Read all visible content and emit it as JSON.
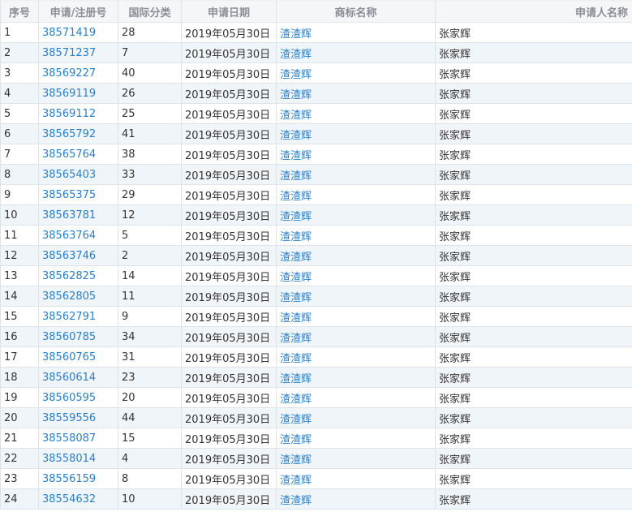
{
  "table": {
    "headers": {
      "seq": "序号",
      "reg_no": "申请/注册号",
      "intl_class": "国际分类",
      "apply_date": "申请日期",
      "tm_name": "商标名称",
      "applicant": "申请人名称"
    },
    "rows": [
      {
        "seq": "1",
        "reg_no": "38571419",
        "intl_class": "28",
        "apply_date": "2019年05月30日",
        "tm_name": "渣渣辉",
        "applicant": "张家辉"
      },
      {
        "seq": "2",
        "reg_no": "38571237",
        "intl_class": "7",
        "apply_date": "2019年05月30日",
        "tm_name": "渣渣辉",
        "applicant": "张家辉"
      },
      {
        "seq": "3",
        "reg_no": "38569227",
        "intl_class": "40",
        "apply_date": "2019年05月30日",
        "tm_name": "渣渣辉",
        "applicant": "张家辉"
      },
      {
        "seq": "4",
        "reg_no": "38569119",
        "intl_class": "26",
        "apply_date": "2019年05月30日",
        "tm_name": "渣渣辉",
        "applicant": "张家辉"
      },
      {
        "seq": "5",
        "reg_no": "38569112",
        "intl_class": "25",
        "apply_date": "2019年05月30日",
        "tm_name": "渣渣辉",
        "applicant": "张家辉"
      },
      {
        "seq": "6",
        "reg_no": "38565792",
        "intl_class": "41",
        "apply_date": "2019年05月30日",
        "tm_name": "渣渣辉",
        "applicant": "张家辉"
      },
      {
        "seq": "7",
        "reg_no": "38565764",
        "intl_class": "38",
        "apply_date": "2019年05月30日",
        "tm_name": "渣渣辉",
        "applicant": "张家辉"
      },
      {
        "seq": "8",
        "reg_no": "38565403",
        "intl_class": "33",
        "apply_date": "2019年05月30日",
        "tm_name": "渣渣辉",
        "applicant": "张家辉"
      },
      {
        "seq": "9",
        "reg_no": "38565375",
        "intl_class": "29",
        "apply_date": "2019年05月30日",
        "tm_name": "渣渣辉",
        "applicant": "张家辉"
      },
      {
        "seq": "10",
        "reg_no": "38563781",
        "intl_class": "12",
        "apply_date": "2019年05月30日",
        "tm_name": "渣渣辉",
        "applicant": "张家辉"
      },
      {
        "seq": "11",
        "reg_no": "38563764",
        "intl_class": "5",
        "apply_date": "2019年05月30日",
        "tm_name": "渣渣辉",
        "applicant": "张家辉"
      },
      {
        "seq": "12",
        "reg_no": "38563746",
        "intl_class": "2",
        "apply_date": "2019年05月30日",
        "tm_name": "渣渣辉",
        "applicant": "张家辉"
      },
      {
        "seq": "13",
        "reg_no": "38562825",
        "intl_class": "14",
        "apply_date": "2019年05月30日",
        "tm_name": "渣渣辉",
        "applicant": "张家辉"
      },
      {
        "seq": "14",
        "reg_no": "38562805",
        "intl_class": "11",
        "apply_date": "2019年05月30日",
        "tm_name": "渣渣辉",
        "applicant": "张家辉"
      },
      {
        "seq": "15",
        "reg_no": "38562791",
        "intl_class": "9",
        "apply_date": "2019年05月30日",
        "tm_name": "渣渣辉",
        "applicant": "张家辉"
      },
      {
        "seq": "16",
        "reg_no": "38560785",
        "intl_class": "34",
        "apply_date": "2019年05月30日",
        "tm_name": "渣渣辉",
        "applicant": "张家辉"
      },
      {
        "seq": "17",
        "reg_no": "38560765",
        "intl_class": "31",
        "apply_date": "2019年05月30日",
        "tm_name": "渣渣辉",
        "applicant": "张家辉"
      },
      {
        "seq": "18",
        "reg_no": "38560614",
        "intl_class": "23",
        "apply_date": "2019年05月30日",
        "tm_name": "渣渣辉",
        "applicant": "张家辉"
      },
      {
        "seq": "19",
        "reg_no": "38560595",
        "intl_class": "20",
        "apply_date": "2019年05月30日",
        "tm_name": "渣渣辉",
        "applicant": "张家辉"
      },
      {
        "seq": "20",
        "reg_no": "38559556",
        "intl_class": "44",
        "apply_date": "2019年05月30日",
        "tm_name": "渣渣辉",
        "applicant": "张家辉"
      },
      {
        "seq": "21",
        "reg_no": "38558087",
        "intl_class": "15",
        "apply_date": "2019年05月30日",
        "tm_name": "渣渣辉",
        "applicant": "张家辉"
      },
      {
        "seq": "22",
        "reg_no": "38558014",
        "intl_class": "4",
        "apply_date": "2019年05月30日",
        "tm_name": "渣渣辉",
        "applicant": "张家辉"
      },
      {
        "seq": "23",
        "reg_no": "38556159",
        "intl_class": "8",
        "apply_date": "2019年05月30日",
        "tm_name": "渣渣辉",
        "applicant": "张家辉"
      },
      {
        "seq": "24",
        "reg_no": "38554632",
        "intl_class": "10",
        "apply_date": "2019年05月30日",
        "tm_name": "渣渣辉",
        "applicant": "张家辉"
      }
    ]
  },
  "colors": {
    "link": "#2a7ec6",
    "header_bg": "#f5f6f8",
    "header_text": "#8a8f96",
    "row_stripe": "#f0f5fa",
    "border": "#dfe3e8",
    "text": "#333333"
  }
}
